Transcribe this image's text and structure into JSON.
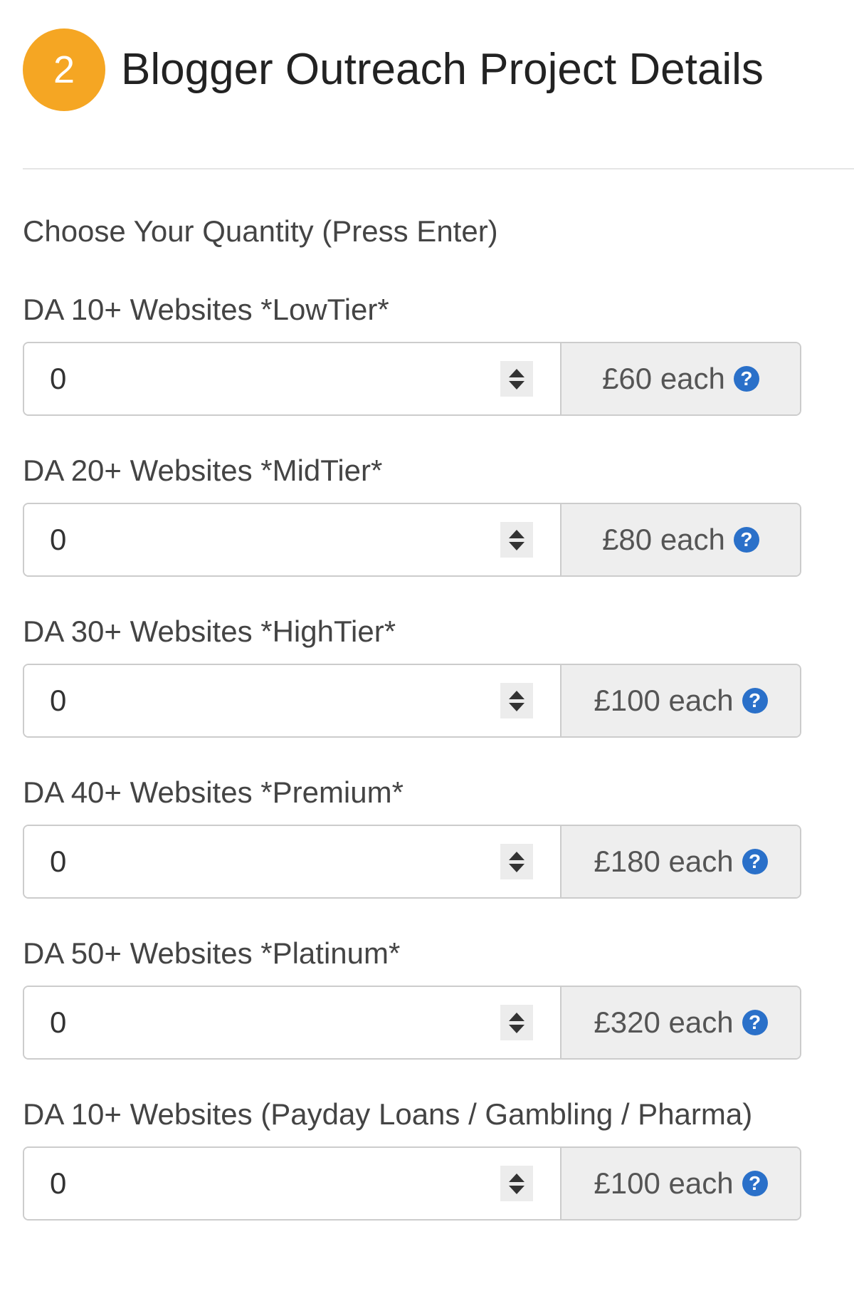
{
  "header": {
    "step_number": "2",
    "title": "Blogger Outreach Project Details"
  },
  "instructions": "Choose Your Quantity (Press Enter)",
  "colors": {
    "step_badge": "#f5a623",
    "help_icon": "#2a70c9",
    "addon_background": "#eeeeee"
  },
  "products": [
    {
      "label": "DA 10+ Websites *LowTier*",
      "quantity": "0",
      "price": "£60 each",
      "icon": "question-circle-icon"
    },
    {
      "label": "DA 20+ Websites *MidTier*",
      "quantity": "0",
      "price": "£80 each",
      "icon": "question-circle-icon"
    },
    {
      "label": "DA 30+ Websites *HighTier*",
      "quantity": "0",
      "price": "£100 each",
      "icon": "question-circle-icon"
    },
    {
      "label": "DA 40+ Websites *Premium*",
      "quantity": "0",
      "price": "£180 each",
      "icon": "question-circle-icon"
    },
    {
      "label": "DA 50+ Websites *Platinum*",
      "quantity": "0",
      "price": "£320 each",
      "icon": "question-circle-icon"
    },
    {
      "label": "DA 10+ Websites (Payday Loans / Gambling / Pharma)",
      "quantity": "0",
      "price": "£100 each",
      "icon": "question-circle-icon"
    }
  ]
}
